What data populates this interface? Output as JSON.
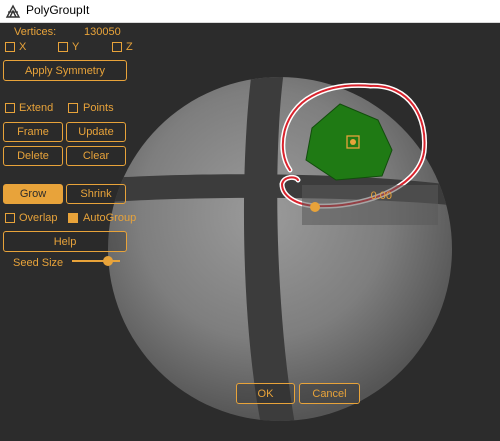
{
  "window": {
    "title": "PolyGroupIt",
    "icon": "polygroupit-app-icon"
  },
  "stats": {
    "vertices_label": "Vertices:",
    "vertices_value": "130050"
  },
  "symmetry": {
    "x_label": "X",
    "x_checked": false,
    "y_label": "Y",
    "y_checked": false,
    "z_label": "Z",
    "z_checked": false,
    "apply_label": "Apply Symmetry"
  },
  "options": {
    "extend_label": "Extend",
    "extend_checked": false,
    "points_label": "Points",
    "points_checked": false
  },
  "buttons": {
    "frame": "Frame",
    "update": "Update",
    "delete": "Delete",
    "clear": "Clear",
    "grow": "Grow",
    "shrink": "Shrink",
    "help": "Help",
    "ok": "OK",
    "cancel": "Cancel"
  },
  "mode": {
    "active": "Grow"
  },
  "flags": {
    "overlap_label": "Overlap",
    "overlap_checked": false,
    "autogroup_label": "AutoGroup",
    "autogroup_checked": true
  },
  "seed": {
    "label": "Seed Size",
    "value_fraction": 0.75
  },
  "overlay_slider": {
    "value": "0.00",
    "value_fraction": 0.0
  },
  "colors": {
    "accent": "#e8a33a",
    "background": "#2c2c2c",
    "polygroup": "#1f7a14",
    "selection_ring": "#d9232d"
  },
  "icons": {
    "seed_marker": "seed-point-icon"
  }
}
